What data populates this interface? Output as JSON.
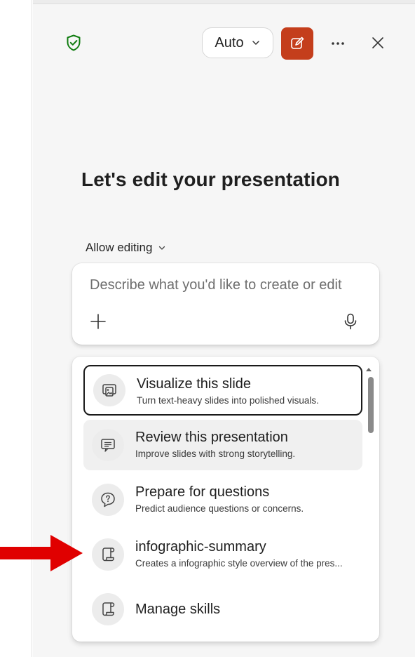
{
  "header": {
    "mode_label": "Auto",
    "new_chat_icon": "compose-icon",
    "more_icon": "more-horizontal-icon",
    "close_icon": "close-icon",
    "shield_icon": "shield-check-icon"
  },
  "main": {
    "headline": "Let's edit your presentation",
    "allow_editing_label": "Allow editing"
  },
  "composer": {
    "placeholder": "Describe what you'd like to create or edit",
    "add_icon": "plus-icon",
    "mic_icon": "microphone-icon"
  },
  "menu": {
    "items": [
      {
        "title": "Visualize this slide",
        "subtitle": "Turn text-heavy slides into polished visuals.",
        "icon": "image-slide-icon",
        "state": "focused"
      },
      {
        "title": "Review this presentation",
        "subtitle": "Improve slides with strong storytelling.",
        "icon": "slide-text-icon",
        "state": "hovered"
      },
      {
        "title": "Prepare for questions",
        "subtitle": "Predict audience questions or concerns.",
        "icon": "chat-question-icon",
        "state": "normal"
      },
      {
        "title": "infographic-summary",
        "subtitle": "Creates a infographic style overview of the pres...",
        "icon": "scroll-skill-icon",
        "state": "normal"
      },
      {
        "title": "Manage skills",
        "subtitle": "",
        "icon": "scroll-skill-icon",
        "state": "normal"
      }
    ]
  },
  "colors": {
    "accent_new_button": "#c43e1c",
    "shield_green": "#107c10",
    "annotation_arrow": "#e00000"
  },
  "annotation": {
    "arrow_icon": "red-arrow-icon"
  }
}
